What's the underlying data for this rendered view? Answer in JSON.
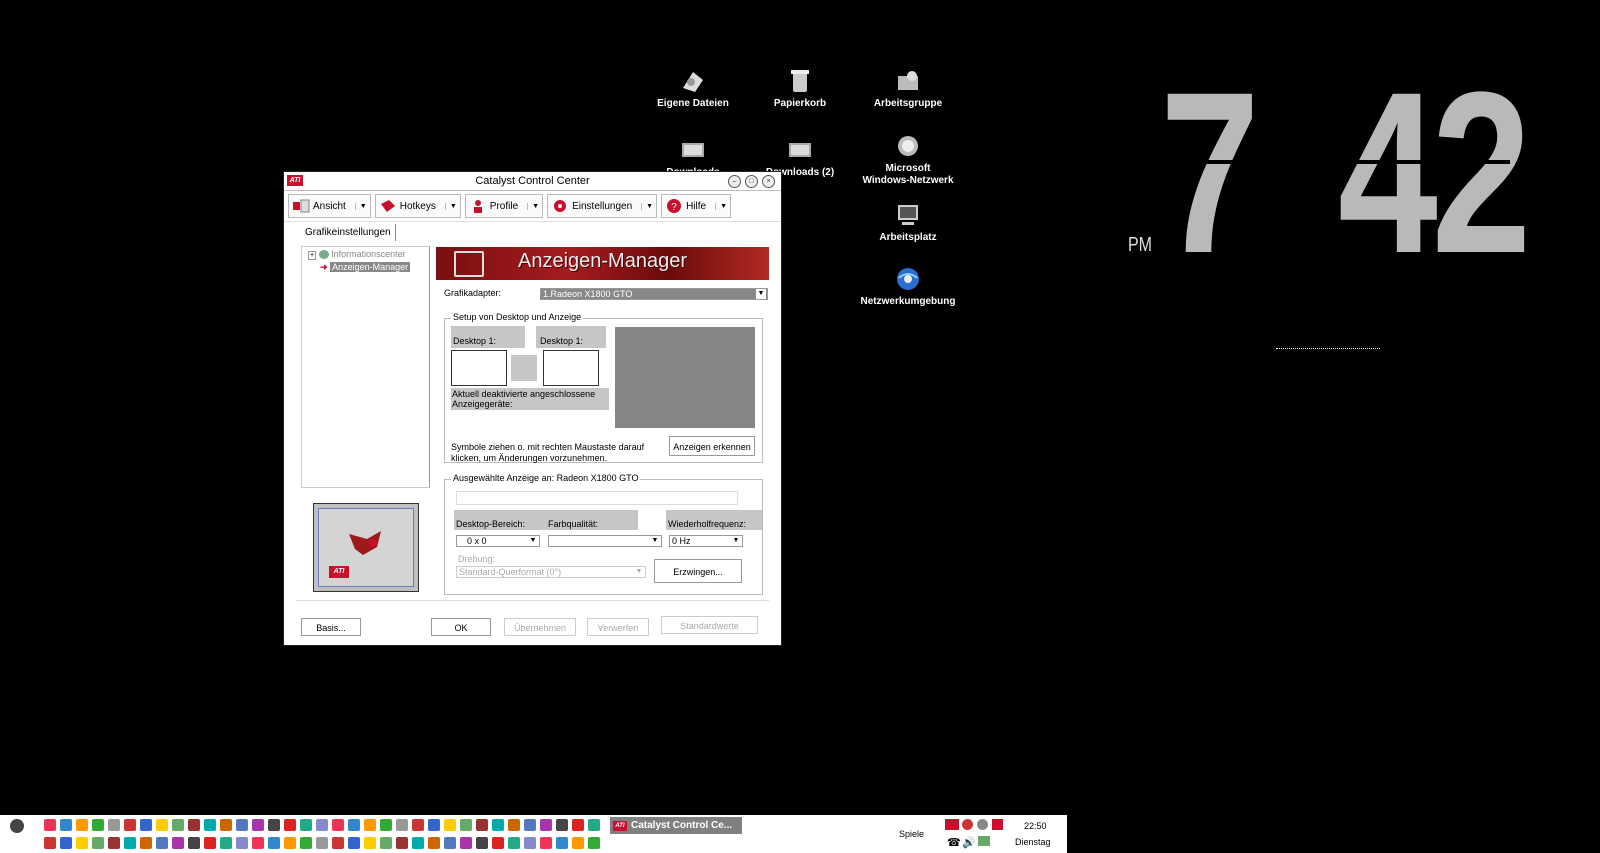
{
  "desktop": {
    "icons": [
      {
        "label": "Eigene Dateien",
        "icon": "my-documents-icon"
      },
      {
        "label": "Papierkorb",
        "icon": "recycle-bin-icon"
      },
      {
        "label": "Arbeitsgruppe",
        "icon": "workgroup-icon"
      },
      {
        "label": "Downloads",
        "icon": "downloads-folder-icon"
      },
      {
        "label": "Downloads (2)",
        "icon": "downloads-folder-icon"
      },
      {
        "label": "Microsoft\nWindows-Netzwerk",
        "icon": "network-icon"
      },
      {
        "label": "Arbeitsplatz",
        "icon": "my-computer-icon"
      },
      {
        "label": "Netzwerkumgebung",
        "icon": "network-globe-icon"
      }
    ]
  },
  "clock": {
    "hour": "7",
    "minute": "42",
    "ampm": "PM"
  },
  "window": {
    "title": "Catalyst Control Center",
    "logo": "ATI",
    "toolbar": [
      {
        "label": "Ansicht",
        "icon": "view-icon"
      },
      {
        "label": "Hotkeys",
        "icon": "hotkeys-icon"
      },
      {
        "label": "Profile",
        "icon": "profile-icon"
      },
      {
        "label": "Einstellungen",
        "icon": "settings-icon"
      },
      {
        "label": "Hilfe",
        "icon": "help-icon"
      }
    ],
    "tab": "Grafikeinstellungen",
    "tree": [
      {
        "label": "Informationscenter",
        "expander": "+"
      },
      {
        "label": "Anzeigen-Manager"
      }
    ],
    "banner_title": "Anzeigen-Manager",
    "grafikadapter": {
      "label": "Grafikadapter:",
      "value": "1.Radeon X1800 GTO"
    },
    "setup": {
      "title": "Setup von Desktop und Anzeige",
      "desktop1": "Desktop 1:",
      "desktop2": "Desktop 1:",
      "deactivated": "Aktuell deaktivierte angeschlossene Anzeigegeräte:",
      "hint": "Symbole ziehen o. mit rechten Maustaste darauf klicken, um Änderungen vorzunehmen.",
      "detect_button": "Anzeigen erkennen"
    },
    "selected": {
      "title": "Ausgewählte Anzeige an: Radeon X1800 GTO",
      "desktop_area_label": "Desktop-Bereich:",
      "desktop_area_value": "0 x   0",
      "color_quality_label": "Farbqualität:",
      "color_quality_value": "",
      "refresh_label": "Wiederholfrequenz:",
      "refresh_value": "0 Hz",
      "rotation_label": "Drehung:",
      "rotation_value": "Standard-Querformat (0°)",
      "force_button": "Erzwingen..."
    },
    "buttons": {
      "basis": "Basis...",
      "ok": "OK",
      "apply": "Übernehmen",
      "discard": "Verwerfen",
      "defaults": "Standardwerte"
    }
  },
  "taskbar": {
    "task_label": "Catalyst Control Ce...",
    "spiele": "Spiele",
    "time": "22:50",
    "day": "Dienstag"
  }
}
